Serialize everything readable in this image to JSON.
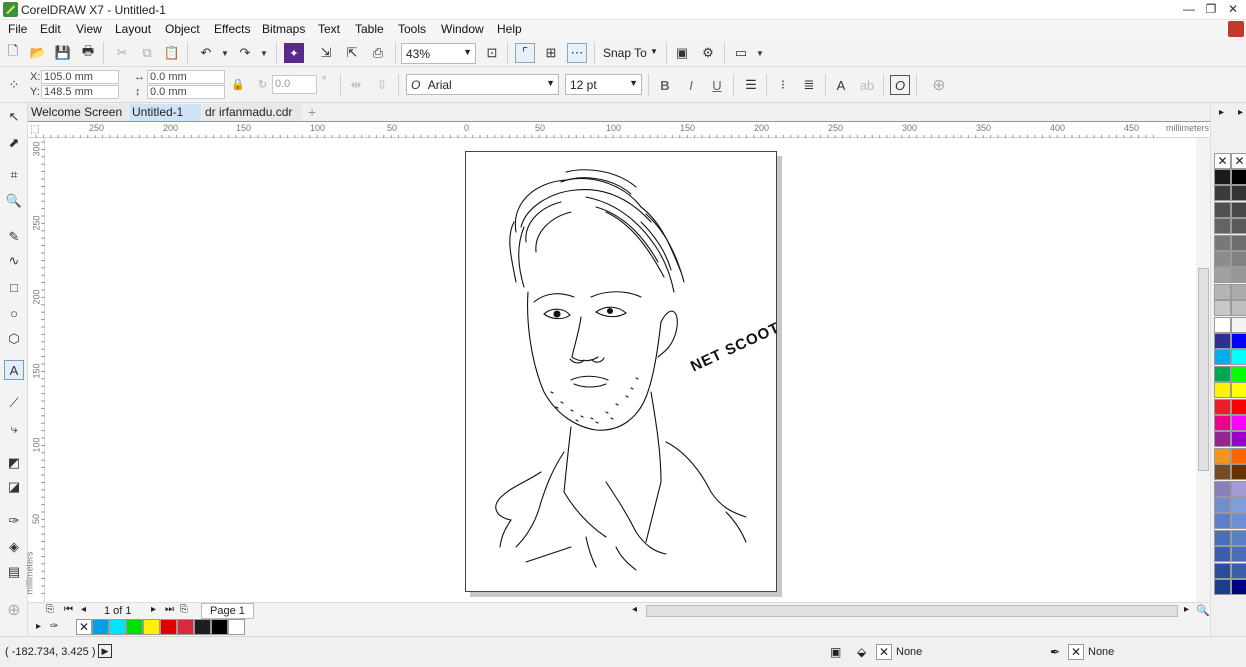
{
  "window": {
    "title": "CorelDRAW X7 - Untitled-1",
    "minimize": "—",
    "restore": "❐",
    "close": "✕"
  },
  "menu": [
    "File",
    "Edit",
    "View",
    "Layout",
    "Object",
    "Effects",
    "Bitmaps",
    "Text",
    "Table",
    "Tools",
    "Window",
    "Help"
  ],
  "toolbar": {
    "zoom": "43%",
    "snap_to": "Snap To"
  },
  "propbar": {
    "x": "105.0 mm",
    "y": "148.5 mm",
    "w": "0.0 mm",
    "h": "0.0 mm",
    "angle": "0.0",
    "degree": "°",
    "x_label": "X:",
    "y_label": "Y:",
    "font_name": "Arial",
    "font_size": "12 pt"
  },
  "tabs": [
    "Welcome Screen",
    "Untitled-1",
    "dr irfanmadu.cdr"
  ],
  "active_tab": 1,
  "ruler": {
    "unit": "millimeters",
    "h_ticks": [
      "250",
      "200",
      "150",
      "100",
      "50",
      "0",
      "50",
      "100",
      "150",
      "200",
      "250",
      "300",
      "350",
      "400",
      "450"
    ],
    "v_ticks": [
      "300",
      "250",
      "200",
      "150",
      "100",
      "50"
    ]
  },
  "artwork": {
    "text": "NET SCOOT"
  },
  "pagebar": {
    "counter": "1 of 1",
    "page_tab": "Page 1"
  },
  "status": {
    "coords": "( -182.734, 3.425 )",
    "fill": "None",
    "outline": "None"
  },
  "palette": {
    "right_col1": [
      "#1a1a1a",
      "#3b3b3b",
      "#505050",
      "#646464",
      "#787878",
      "#8c8c8c",
      "#a0a0a0",
      "#b4b4b4",
      "#c8c8c8",
      "#ffffff",
      "#2e3192",
      "#00aeef",
      "#00a651",
      "#fff200",
      "#ed1c24",
      "#ec008c",
      "#92278f",
      "#f7941d",
      "#754c24",
      "#8781bd",
      "#6f8fd0",
      "#5b7fc8",
      "#4a6fb8",
      "#3a5fa8",
      "#2a4f98",
      "#1a3f88"
    ],
    "right_col2": [
      "#000000",
      "#333333",
      "#474747",
      "#5a5a5a",
      "#6e6e6e",
      "#828282",
      "#969696",
      "#aaaaaa",
      "#bebebe",
      "#f2f2f2",
      "#0000ff",
      "#00ffff",
      "#00ff00",
      "#ffff00",
      "#ff0000",
      "#ff00ff",
      "#9900cc",
      "#ff6600",
      "#663300",
      "#a29bd6",
      "#7f9fe0",
      "#6b8fd8",
      "#5a7fc8",
      "#4a6fb8",
      "#3a5fa8",
      "#000080"
    ],
    "doc": [
      "#00a0e6",
      "#00e5ff",
      "#00e000",
      "#ffef00",
      "#e00000",
      "#d52b3c",
      "#1e1e1e",
      "#000000",
      "#ffffff"
    ]
  }
}
